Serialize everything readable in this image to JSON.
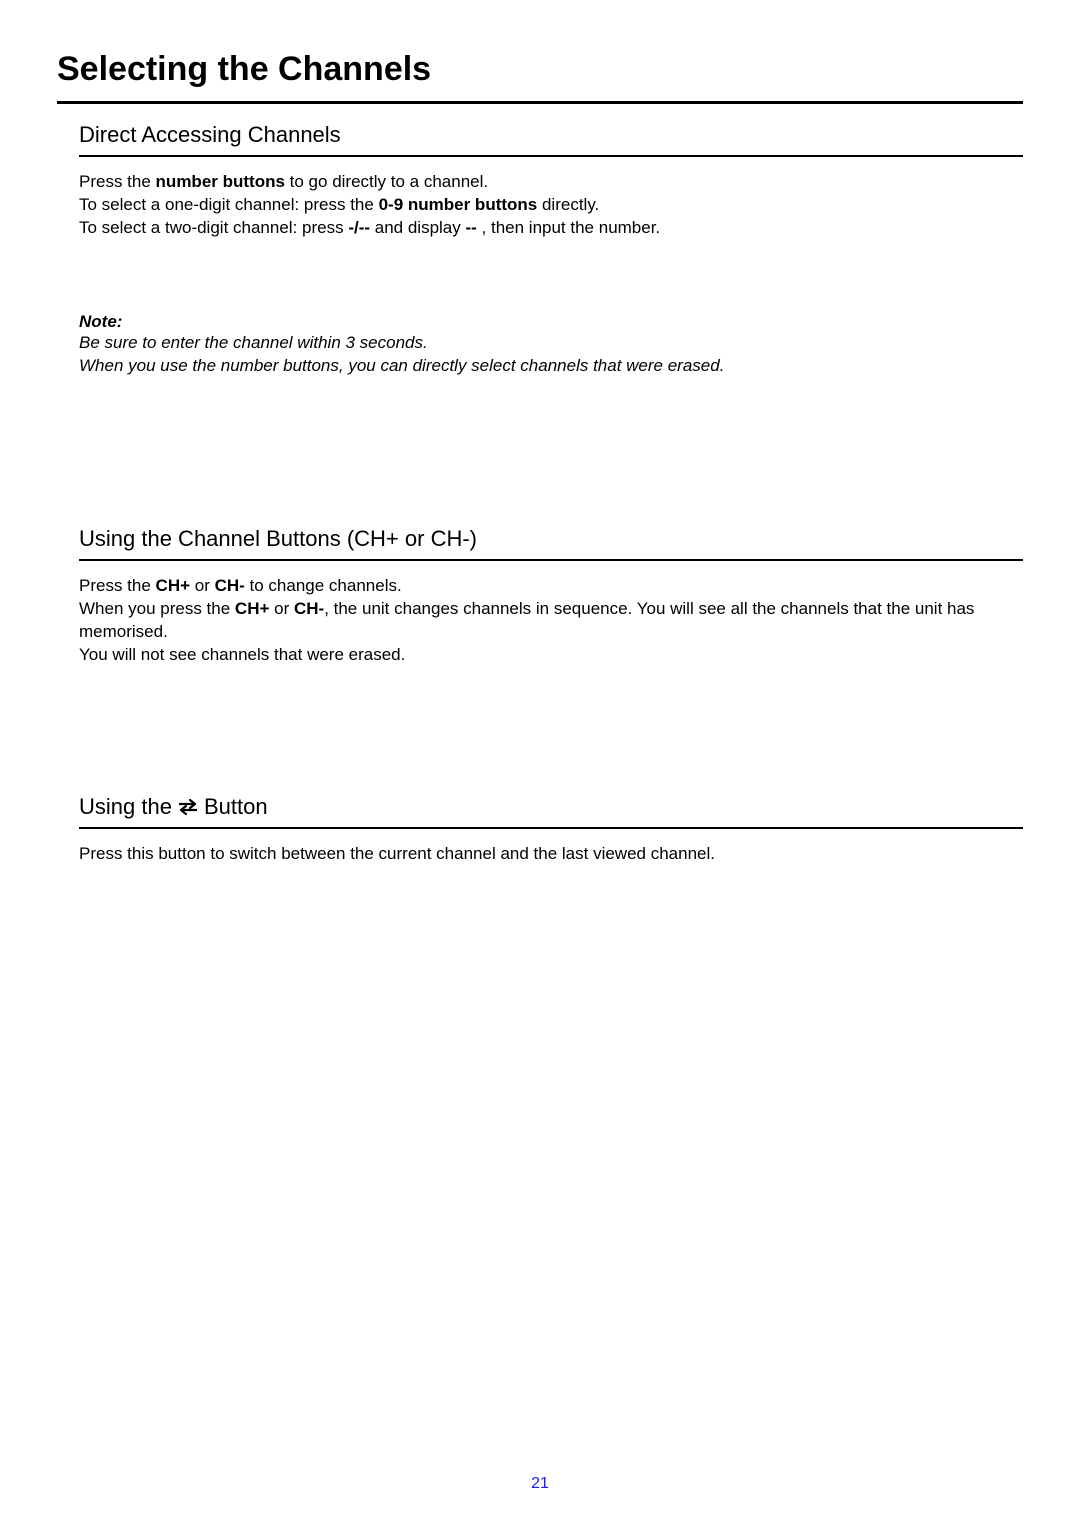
{
  "page": {
    "title": "Selecting the Channels",
    "number": "21"
  },
  "section1": {
    "heading": "Direct Accessing Channels",
    "line1a": "Press the ",
    "line1b": "number buttons",
    "line1c": " to go directly to a channel.",
    "line2a": "To select a one-digit channel: press the ",
    "line2b": "0-9 number buttons",
    "line2c": " directly.",
    "line3a": "To select a two-digit channel: press ",
    "line3b": "-/--",
    "line3c": " and display ",
    "line3d": "--",
    "line3e": " , then input the number.",
    "noteLabel": "Note:",
    "note1": "Be sure to enter the channel within 3 seconds.",
    "note2": "When you use the number buttons, you can directly select channels that were erased."
  },
  "section2": {
    "heading": "Using the Channel Buttons (CH+ or CH-)",
    "line1a": "Press the ",
    "line1b": "CH+",
    "line1c": " or ",
    "line1d": "CH-",
    "line1e": " to change channels.",
    "line2a": "When you press the ",
    "line2b": "CH+",
    "line2c": " or ",
    "line2d": "CH-",
    "line2e": ", the unit changes channels in sequence. You will see all the channels that the unit has memorised.",
    "line3": "You will not see channels that were erased."
  },
  "section3": {
    "headingPre": "Using the ",
    "headingPost": " Button",
    "body": "Press this button to switch between the current channel and the last viewed channel."
  }
}
